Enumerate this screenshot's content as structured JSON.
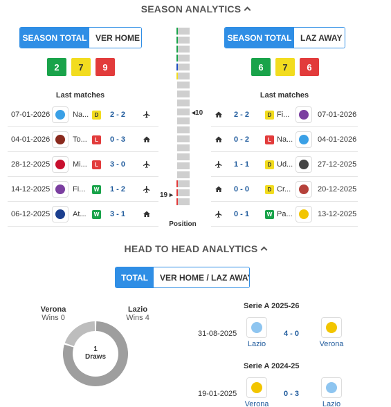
{
  "season": {
    "title": "SEASON ANALYTICS",
    "home": {
      "tabs": [
        "SEASON TOTAL",
        "VER HOME"
      ],
      "record": {
        "w": "2",
        "d": "7",
        "l": "9"
      },
      "last_title": "Last matches",
      "matches": [
        {
          "date": "07-01-2026",
          "team": "Na...",
          "crest": "#3aa0e6",
          "res": "D",
          "score": "2 - 2",
          "venue": "plane-icon"
        },
        {
          "date": "04-01-2026",
          "team": "To...",
          "crest": "#8a2a1e",
          "res": "L",
          "score": "0 - 3",
          "venue": "home-icon"
        },
        {
          "date": "28-12-2025",
          "team": "Mi...",
          "crest": "#c8102e",
          "res": "L",
          "score": "3 - 0",
          "venue": "plane-icon"
        },
        {
          "date": "14-12-2025",
          "team": "Fi...",
          "crest": "#7b3fa0",
          "res": "W",
          "score": "1 - 2",
          "venue": "plane-icon"
        },
        {
          "date": "06-12-2025",
          "team": "At...",
          "crest": "#1c3f8f",
          "res": "W",
          "score": "3 - 1",
          "venue": "home-icon"
        }
      ]
    },
    "away": {
      "tabs": [
        "SEASON TOTAL",
        "LAZ AWAY"
      ],
      "record": {
        "w": "6",
        "d": "7",
        "l": "6"
      },
      "last_title": "Last matches",
      "matches": [
        {
          "date": "07-01-2026",
          "team": "Fi...",
          "crest": "#7b3fa0",
          "res": "D",
          "score": "2 - 2",
          "venue": "home-icon"
        },
        {
          "date": "04-01-2026",
          "team": "Na...",
          "crest": "#3aa0e6",
          "res": "L",
          "score": "0 - 2",
          "venue": "home-icon"
        },
        {
          "date": "27-12-2025",
          "team": "Ud...",
          "crest": "#444444",
          "res": "D",
          "score": "1 - 1",
          "venue": "plane-icon"
        },
        {
          "date": "20-12-2025",
          "team": "Cr...",
          "crest": "#b5413a",
          "res": "D",
          "score": "0 - 0",
          "venue": "home-icon"
        },
        {
          "date": "13-12-2025",
          "team": "Pa...",
          "crest": "#f2c500",
          "res": "W",
          "score": "0 - 1",
          "venue": "plane-icon"
        }
      ]
    },
    "position": {
      "label": "Position",
      "home_rank": "19",
      "away_rank": "10"
    }
  },
  "h2h": {
    "title": "HEAD TO HEAD ANALYTICS",
    "tabs": [
      "TOTAL",
      "VER HOME / LAZ AWAY"
    ],
    "home_name": "Verona",
    "home_wins": "Wins 0",
    "away_name": "Lazio",
    "away_wins": "Wins 4",
    "draws_count": "1",
    "draws_label": "Draws",
    "donut": {
      "home": 0,
      "draws": 1,
      "away": 4,
      "home_color": "#f2dc1f",
      "draws_color": "#bdbdbd",
      "away_color": "#9e9e9e"
    },
    "matches": [
      {
        "comp": "Serie A 2025-26",
        "date": "31-08-2025",
        "home": "Lazio",
        "score": "4 - 0",
        "away": "Verona"
      },
      {
        "comp": "Serie A 2024-25",
        "date": "19-01-2025",
        "home": "Verona",
        "score": "0 - 3",
        "away": "Lazio"
      }
    ]
  }
}
